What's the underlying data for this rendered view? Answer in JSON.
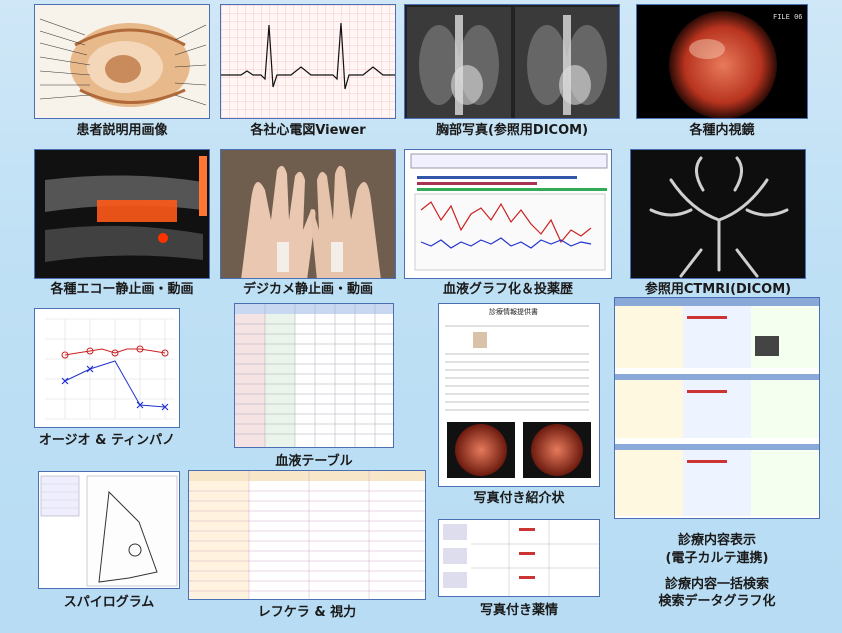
{
  "captions": {
    "anatomy": "患者説明用画像",
    "ecg": "各社心電図Viewer",
    "chest": "胸部写真(参照用DICOM)",
    "endoscopy": "各種内視鏡",
    "echo": "各種エコー静止画・動画",
    "camera": "デジカメ静止画・動画",
    "bloodgraph": "血液グラフ化＆投薬歴",
    "ctmri": "参照用CTMRI(DICOM)",
    "audio": "オージオ & ティンパノ",
    "bloodtable": "血液テーブル",
    "referral": "写真付き紹介状",
    "karte_line1": "診療内容表示",
    "karte_line2": "(電子カルテ連携)",
    "search_line1": "診療内容一括検索",
    "search_line2": "検索データグラフ化",
    "spiro": "スパイログラム",
    "refkera": "レフケラ & 視力",
    "drug": "写真付き薬情"
  },
  "thumb_text": {
    "endoscopy_label": "FILE 06",
    "referral_title": "診療情報提供書"
  },
  "colors": {
    "border": "#4a6fb5",
    "background": "#bfe0f5",
    "ecg_grid": "#f2a6a6",
    "graph_red": "#cc2222",
    "graph_blue": "#2233cc"
  }
}
